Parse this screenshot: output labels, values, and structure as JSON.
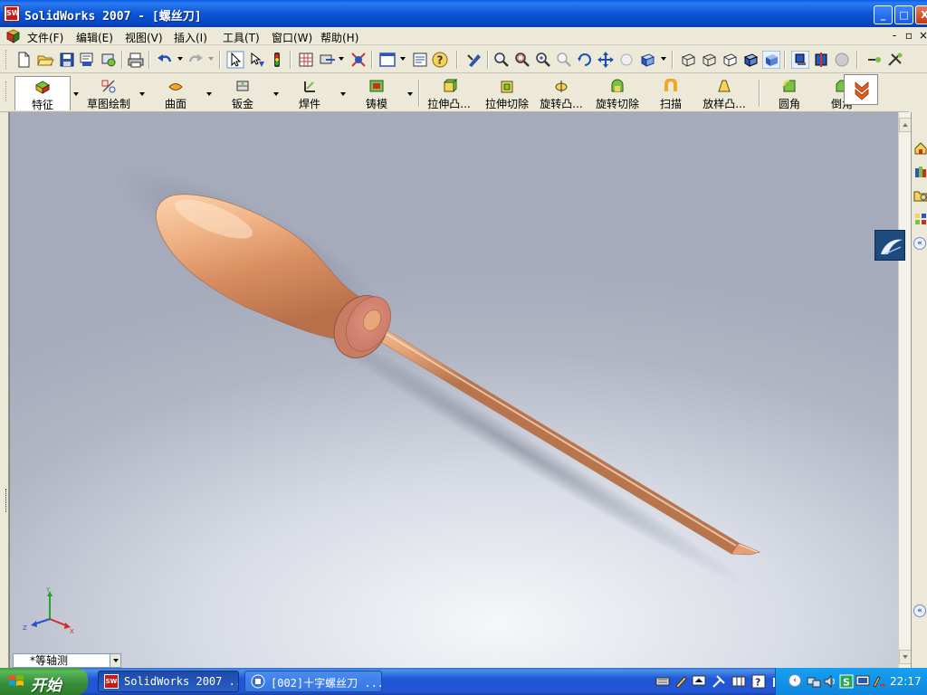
{
  "window": {
    "title": "SolidWorks 2007 - [螺丝刀]",
    "logo_text": "SW",
    "min_label": "_",
    "max_label": "□",
    "close_label": "X"
  },
  "menu": {
    "items": [
      "文件(F)",
      "编辑(E)",
      "视图(V)",
      "插入(I)",
      "工具(T)",
      "窗口(W)",
      "帮助(H)"
    ],
    "mdi_min": "-",
    "mdi_restore": "▫",
    "mdi_close": "×"
  },
  "command_manager": {
    "tabs": [
      "特征",
      "草图绘制",
      "曲面",
      "钣金",
      "焊件",
      "铸模"
    ],
    "commands": [
      "拉伸凸...",
      "拉伸切除",
      "旋转凸...",
      "旋转切除",
      "扫描",
      "放样凸...",
      "圆角",
      "倒角"
    ]
  },
  "viewport": {
    "view_orientation": "*等轴测",
    "triad_labels": {
      "x": "X",
      "y": "Y",
      "z": "Z"
    },
    "model": "screwdriver",
    "colors": {
      "handle": "#e8a477",
      "shaft": "#e6a77c",
      "background": "#b0b6c4"
    }
  },
  "taskbar": {
    "start_label": "开始",
    "tasks": [
      "SolidWorks 2007 ...",
      "[002]十字螺丝刀 ..."
    ],
    "clock": "22:17"
  },
  "icons": {
    "title_logo": "solidworks-logo-icon",
    "pm_button": "property-manager-icon",
    "flyout": "expand-toolbar-icon"
  }
}
